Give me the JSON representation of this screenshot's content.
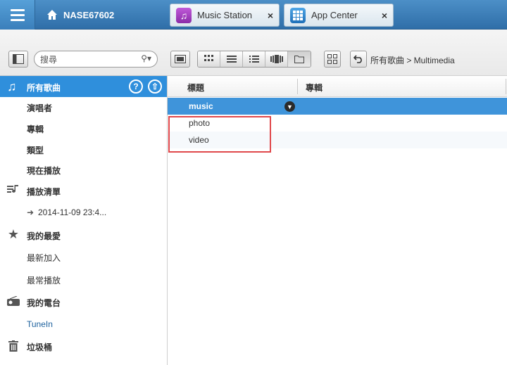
{
  "topbar": {
    "nas_name": "NASE67602",
    "tabs": [
      {
        "label": "Music Station",
        "icon": "music-note-icon",
        "color": "#9b35b8"
      },
      {
        "label": "App Center",
        "icon": "grid-icon",
        "color": "#2f7fd0"
      }
    ]
  },
  "toolbar": {
    "search_placeholder": "搜尋",
    "breadcrumb": "所有歌曲 > Multimedia"
  },
  "sidebar": {
    "header": "所有歌曲",
    "items": [
      {
        "label": "演唱者"
      },
      {
        "label": "專輯"
      },
      {
        "label": "類型"
      },
      {
        "label": "現在播放"
      },
      {
        "label": "播放清單"
      },
      {
        "label": "2014-11-09 23:4..."
      },
      {
        "label": "我的最愛"
      },
      {
        "label": "最新加入"
      },
      {
        "label": "最常播放"
      },
      {
        "label": "我的電台"
      },
      {
        "label": "TuneIn"
      },
      {
        "label": "垃圾桶"
      }
    ]
  },
  "content": {
    "columns": [
      "標題",
      "專輯"
    ],
    "rows": [
      "music",
      "photo",
      "video"
    ]
  }
}
